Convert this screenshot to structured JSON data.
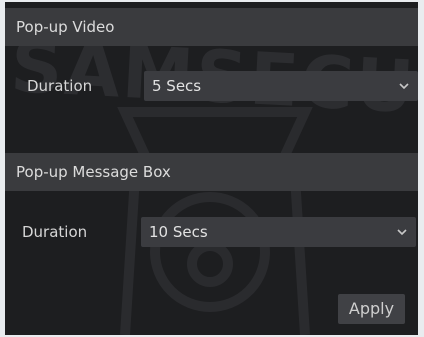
{
  "watermark": "SAMSECU",
  "popup_video": {
    "title": "Pop-up Video",
    "duration_label": "Duration",
    "duration_value": "5 Secs"
  },
  "popup_message_box": {
    "title": "Pop-up Message Box",
    "duration_label": "Duration",
    "duration_value": "10 Secs"
  },
  "apply_label": "Apply",
  "icons": {
    "dropdown": "chevron-down-icon"
  }
}
